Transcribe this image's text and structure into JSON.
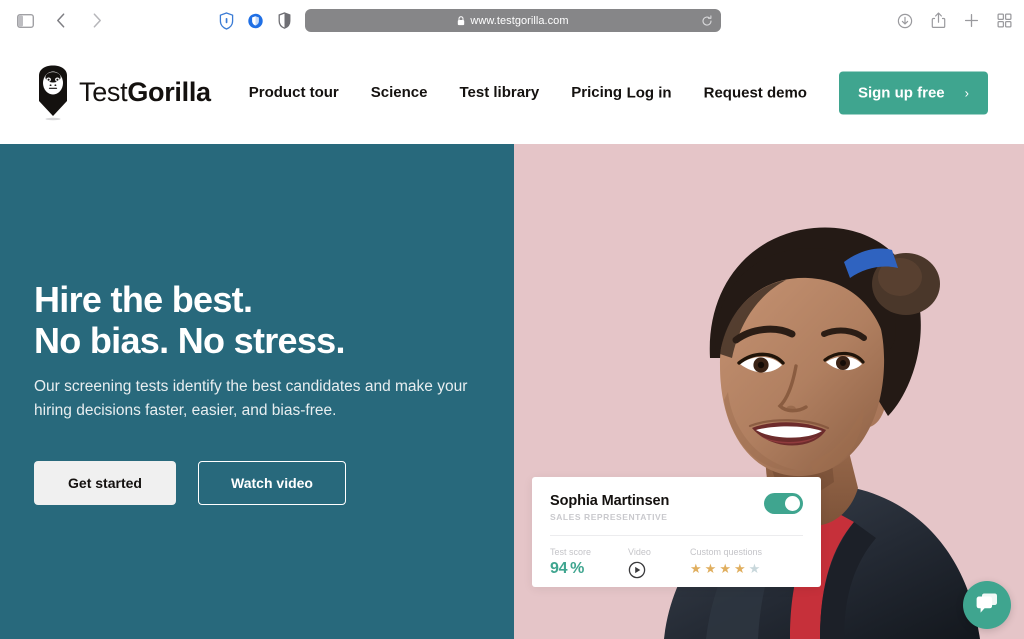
{
  "browser": {
    "sidebar_toggle": "sidebar-toggle",
    "back": "back",
    "forward": "forward",
    "extensions": [
      "shield-outline-icon",
      "shield-filled-icon",
      "reader-contrast-icon"
    ],
    "url": "www.testgorilla.com",
    "lock": "lock-icon",
    "reload": "reload-icon",
    "right_actions": [
      "downloads-icon",
      "share-icon",
      "new-tab-icon",
      "tab-overview-icon"
    ]
  },
  "header": {
    "brand_thin": "Test",
    "brand_bold": "Gorilla",
    "logo_name": "testgorilla-gorilla-logo",
    "nav": [
      {
        "label": "Product tour"
      },
      {
        "label": "Science"
      },
      {
        "label": "Test library"
      },
      {
        "label": "Pricing"
      }
    ],
    "nav_right": [
      {
        "label": "Log in"
      },
      {
        "label": "Request demo"
      }
    ],
    "signup_label": "Sign up free",
    "signup_chevron": "›",
    "accent_green": "#3fa58f"
  },
  "hero": {
    "title_line1": "Hire the best.",
    "title_line2": "No bias. No stress.",
    "subtitle_line1": "Our screening tests identify the best candidates and make your",
    "subtitle_line2": "hiring decisions faster, easier, and bias-free.",
    "cta_primary": "Get started",
    "cta_secondary": "Watch video",
    "bg_left": "#28697c",
    "bg_right": "#e5c5c8"
  },
  "candidate_card": {
    "name": "Sophia Martinsen",
    "role": "SALES REPRESENTATIVE",
    "toggle_state": "on",
    "metrics": [
      {
        "label": "Test score",
        "value": "94 %"
      },
      {
        "label": "Video",
        "value": "play-icon"
      },
      {
        "label": "Custom questions",
        "value": "4 of 5 stars"
      }
    ],
    "stars_filled": 4,
    "stars_total": 5,
    "star_color": "#e0ae5e",
    "star_empty_color": "#c8d7db"
  },
  "chat": {
    "name": "chat-widget",
    "color": "#3fa58f"
  }
}
